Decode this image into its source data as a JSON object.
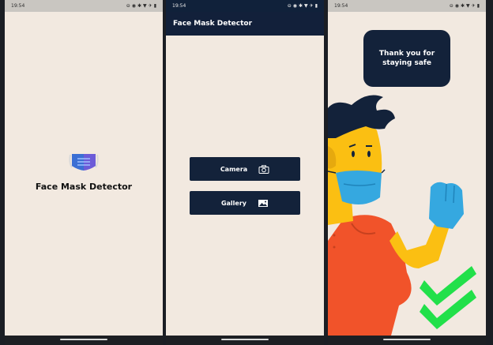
{
  "status": {
    "time": "19:54",
    "icons": [
      "minus-circle-icon",
      "data-saver-icon",
      "bluetooth-icon",
      "wifi-icon",
      "airplane-icon",
      "battery-icon"
    ]
  },
  "splash": {
    "title": "Face Mask Detector"
  },
  "home": {
    "appbar_title": "Face Mask Detector",
    "camera_label": "Camera",
    "gallery_label": "Gallery"
  },
  "result": {
    "message_line1": "Thank you for",
    "message_line2": "staying safe"
  },
  "colors": {
    "background": "#f2e9e0",
    "primary": "#13223a",
    "accent_green": "#22e04a",
    "mask_blue": "#4a8bd8"
  }
}
